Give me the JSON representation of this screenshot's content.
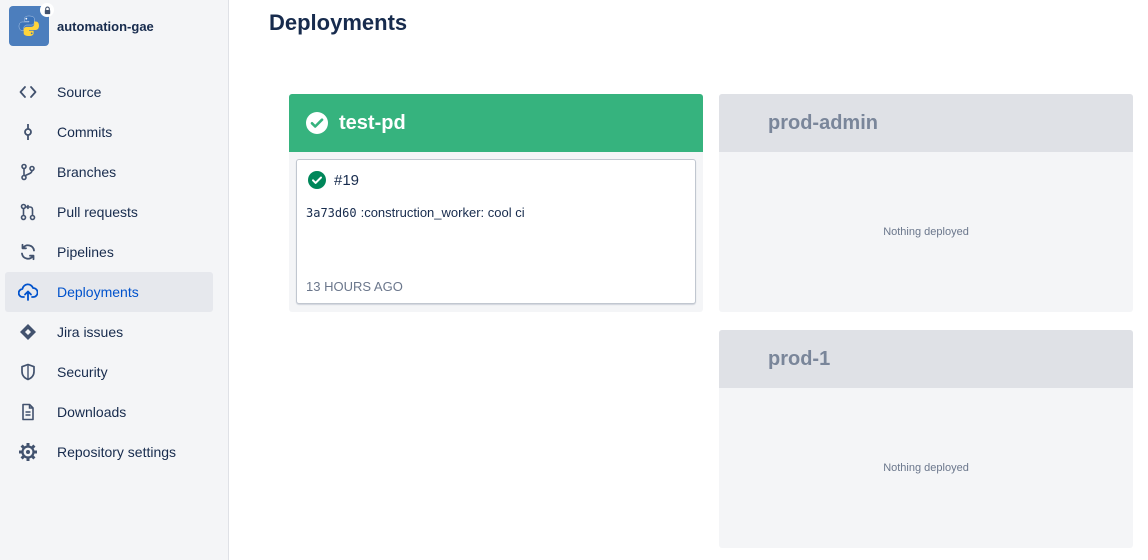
{
  "repo": {
    "name": "automation-gae",
    "avatar_icon": "python-logo-icon",
    "badge_icon": "lock-icon"
  },
  "sidebar": {
    "items": [
      {
        "label": "Source",
        "icon": "code-icon"
      },
      {
        "label": "Commits",
        "icon": "commit-icon"
      },
      {
        "label": "Branches",
        "icon": "branch-icon"
      },
      {
        "label": "Pull requests",
        "icon": "pull-request-icon"
      },
      {
        "label": "Pipelines",
        "icon": "pipelines-icon"
      },
      {
        "label": "Deployments",
        "icon": "deployments-icon",
        "active": true
      },
      {
        "label": "Jira issues",
        "icon": "jira-icon"
      },
      {
        "label": "Security",
        "icon": "shield-icon"
      },
      {
        "label": "Downloads",
        "icon": "document-icon"
      },
      {
        "label": "Repository settings",
        "icon": "gear-icon"
      }
    ]
  },
  "page": {
    "title": "Deployments"
  },
  "environments": {
    "test_pd": {
      "name": "test-pd",
      "status": "success",
      "deployment": {
        "number": "#19",
        "commit_hash": "3a73d60",
        "commit_message": ":construction_worker: cool ci",
        "time": "13 HOURS AGO"
      }
    },
    "prod_admin": {
      "name": "prod-admin",
      "empty_text": "Nothing deployed"
    },
    "prod_1": {
      "name": "prod-1",
      "empty_text": "Nothing deployed"
    }
  },
  "colors": {
    "accent": "#0052cc",
    "success": "#36b37e",
    "success_dark": "#00875a",
    "empty_header": "#dfe1e6",
    "sidebar_bg": "#f4f5f7"
  }
}
